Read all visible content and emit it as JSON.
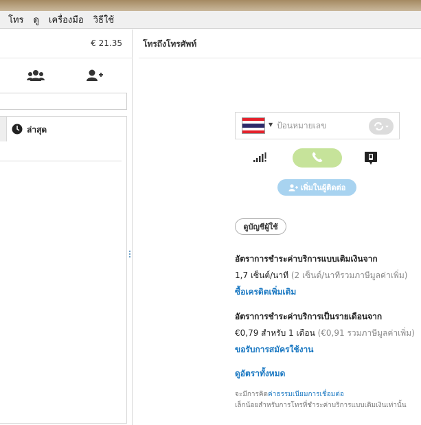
{
  "menu": {
    "items": [
      "ี",
      "โทร",
      "ดู",
      "เครื่องมือ",
      "วิธีใช้"
    ]
  },
  "left": {
    "balance": "€ 21.35",
    "recent_tab_label": "ล่าสุด"
  },
  "right": {
    "title": "โทรถึงโทรศัพท์",
    "dial": {
      "placeholder": "ป้อนหมายเลข",
      "country": "Thailand"
    },
    "add_contact_label": "เพิ่มในผู้ติดต่อ",
    "account_button_label": "ดูบัญชีผู้ใช้",
    "payg": {
      "title": "อัตราการชำระค่าบริการแบบเติมเงินจาก",
      "rate": "1,7 เซ็นต์/นาที",
      "rate_note": "(2 เซ็นต์/นาทีรวมภาษีมูลค่าเพิ่ม)",
      "link": "ซื้อเครดิตเพิ่มเติม"
    },
    "monthly": {
      "title": "อัตราการชำระค่าบริการเป็นรายเดือนจาก",
      "rate": "€0,79 สำหรับ 1 เดือน",
      "rate_note": "(€0,91 รวมภาษีมูลค่าเพิ่ม)",
      "link": "ขอรับการสมัครใช้งาน"
    },
    "all_rates_link": "ดูอัตราทั้งหมด",
    "note": {
      "prefix": "จะมีการคิด",
      "link": "ค่าธรรมเนียมการเชื่อมต่อ",
      "suffix": "เล็กน้อยสำหรับการโทรที่ชำระค่าบริการแบบเติมเงินเท่านั้น"
    }
  },
  "colors": {
    "call_green": "#c6e39a",
    "add_contact_blue": "#a8d3f0",
    "link_blue": "#1a78c2"
  },
  "icons": {
    "group": "group-icon",
    "add_person": "add-person-icon",
    "clock": "clock-icon",
    "signal": "signal-icon",
    "phone": "phone-icon",
    "dialpad": "dialpad-icon",
    "refresh": "refresh-icon"
  }
}
